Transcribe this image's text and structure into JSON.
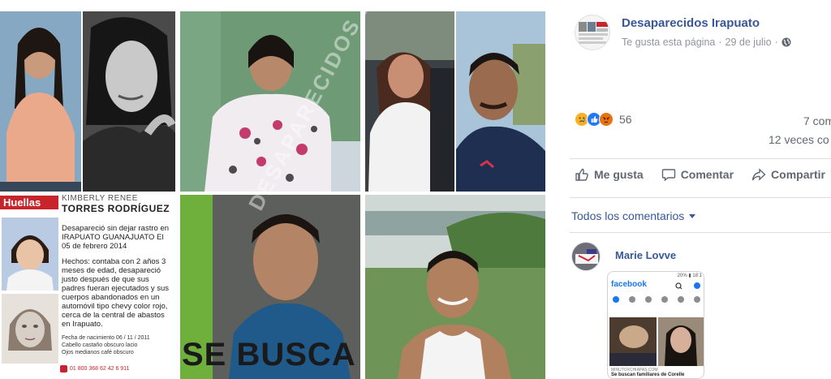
{
  "post": {
    "page_name": "Desaparecidos Irapuato",
    "page_liked": "Te gusta esta página",
    "separator": "·",
    "date": "29 de julio",
    "privacy_icon": "globe-icon",
    "reactions": {
      "icons": [
        "sad-reaction-icon",
        "like-reaction-icon",
        "angry-reaction-icon"
      ],
      "count": "56"
    },
    "comments_count": "7 com",
    "shares_count": "12 veces co",
    "actions": {
      "like": "Me gusta",
      "comment": "Comentar",
      "share": "Compartir"
    },
    "comment_filter": "Todos los comentarios",
    "comment": {
      "author": "Marie Lovve"
    }
  },
  "collage": {
    "flyer": {
      "brand": "Huellas",
      "first_name": "KIMBERLY RENEE",
      "surname": "TORRES RODRÍGUEZ",
      "paragraph1": "Desapareció sin dejar rastro en IRAPUATO GUANAJUATO El 05 de febrero 2014",
      "paragraph2": "Hechos: contaba con 2 años 3 meses de edad, desapareció justo después de que sus padres fueran ejecutados y sus cuerpos abandonados en un automóvil tipo chevy color rojo, cerca de la central de abastos en Irapuato.",
      "birth": "Fecha de nacimiento 06 / 11 / 2011",
      "hair": "Cabello castaño obscuro lacio",
      "eyes": "Ojos medianos café obscuro",
      "phone": "01 800 368 62 42 6 911"
    },
    "se_busca": "SE BUSCA",
    "watermark": "DESAPARECIDOS IRAPUATO"
  },
  "phone_screenshot": {
    "status": "20% ▮ 18:1",
    "app_logo": "facebook",
    "site": "MINUTOXCHIAPAS.COM",
    "headline": "Se buscan familiares de Corelle"
  },
  "colors": {
    "link_blue": "#385898",
    "meta_gray": "#90949c",
    "flyer_red": "#c8242b"
  }
}
